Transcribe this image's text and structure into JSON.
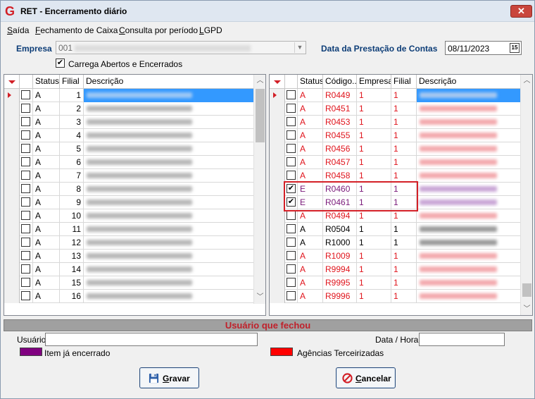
{
  "window": {
    "title": "RET - Encerramento diário",
    "close_glyph": "✕"
  },
  "menu": [
    {
      "label": "Saída"
    },
    {
      "label": "Fechamento de Caixa"
    },
    {
      "label": "Consulta por período"
    },
    {
      "label": "LGPD"
    }
  ],
  "empresa": {
    "label": "Empresa",
    "value": "001"
  },
  "prestacao": {
    "label": "Data da Prestação de Contas",
    "value": "08/11/2023",
    "calendar_glyph": "15"
  },
  "carrega": {
    "label": "Carrega Abertos e Encerrados",
    "checked": true
  },
  "left_grid": {
    "headers": {
      "status": "Status",
      "filial": "Filial",
      "descricao": "Descrição"
    },
    "rows": [
      {
        "status": "A",
        "filial": "1"
      },
      {
        "status": "A",
        "filial": "2"
      },
      {
        "status": "A",
        "filial": "3"
      },
      {
        "status": "A",
        "filial": "4"
      },
      {
        "status": "A",
        "filial": "5"
      },
      {
        "status": "A",
        "filial": "6"
      },
      {
        "status": "A",
        "filial": "7"
      },
      {
        "status": "A",
        "filial": "8"
      },
      {
        "status": "A",
        "filial": "9"
      },
      {
        "status": "A",
        "filial": "10"
      },
      {
        "status": "A",
        "filial": "11"
      },
      {
        "status": "A",
        "filial": "12"
      },
      {
        "status": "A",
        "filial": "13"
      },
      {
        "status": "A",
        "filial": "14"
      },
      {
        "status": "A",
        "filial": "15"
      },
      {
        "status": "A",
        "filial": "16"
      }
    ]
  },
  "right_grid": {
    "headers": {
      "status": "Status",
      "codigo": "Código...",
      "empresa": "Empresa",
      "filial": "Filial",
      "descricao": "Descrição"
    },
    "rows": [
      {
        "status": "A",
        "codigo": "R0449",
        "empresa": "1",
        "filial": "1",
        "color": "#e0141c",
        "checked": false
      },
      {
        "status": "A",
        "codigo": "R0451",
        "empresa": "1",
        "filial": "1",
        "color": "#e0141c",
        "checked": false
      },
      {
        "status": "A",
        "codigo": "R0453",
        "empresa": "1",
        "filial": "1",
        "color": "#e0141c",
        "checked": false
      },
      {
        "status": "A",
        "codigo": "R0455",
        "empresa": "1",
        "filial": "1",
        "color": "#e0141c",
        "checked": false
      },
      {
        "status": "A",
        "codigo": "R0456",
        "empresa": "1",
        "filial": "1",
        "color": "#e0141c",
        "checked": false
      },
      {
        "status": "A",
        "codigo": "R0457",
        "empresa": "1",
        "filial": "1",
        "color": "#e0141c",
        "checked": false
      },
      {
        "status": "A",
        "codigo": "R0458",
        "empresa": "1",
        "filial": "1",
        "color": "#e0141c",
        "checked": false
      },
      {
        "status": "E",
        "codigo": "R0460",
        "empresa": "1",
        "filial": "1",
        "color": "#7a1a7a",
        "checked": true
      },
      {
        "status": "E",
        "codigo": "R0461",
        "empresa": "1",
        "filial": "1",
        "color": "#7a1a7a",
        "checked": true
      },
      {
        "status": "A",
        "codigo": "R0494",
        "empresa": "1",
        "filial": "1",
        "color": "#e0141c",
        "checked": false
      },
      {
        "status": "A",
        "codigo": "R0504",
        "empresa": "1",
        "filial": "1",
        "color": "#000000",
        "checked": false
      },
      {
        "status": "A",
        "codigo": "R1000",
        "empresa": "1",
        "filial": "1",
        "color": "#000000",
        "checked": false
      },
      {
        "status": "A",
        "codigo": "R1009",
        "empresa": "1",
        "filial": "1",
        "color": "#e0141c",
        "checked": false
      },
      {
        "status": "A",
        "codigo": "R9994",
        "empresa": "1",
        "filial": "1",
        "color": "#e0141c",
        "checked": false
      },
      {
        "status": "A",
        "codigo": "R9995",
        "empresa": "1",
        "filial": "1",
        "color": "#e0141c",
        "checked": false
      },
      {
        "status": "A",
        "codigo": "R9996",
        "empresa": "1",
        "filial": "1",
        "color": "#e0141c",
        "checked": false
      }
    ]
  },
  "section": {
    "title": "Usuário que fechou"
  },
  "usuario": {
    "label": "Usuário",
    "value": ""
  },
  "datahora": {
    "label": "Data / Hora",
    "value": ""
  },
  "legend": {
    "encerrado": {
      "label": "Item já encerrado",
      "color": "#800080"
    },
    "terceirizadas": {
      "label": "Agências Terceirizadas",
      "color": "#ff0000"
    }
  },
  "buttons": {
    "gravar": "Gravar",
    "cancelar": "Cancelar"
  }
}
